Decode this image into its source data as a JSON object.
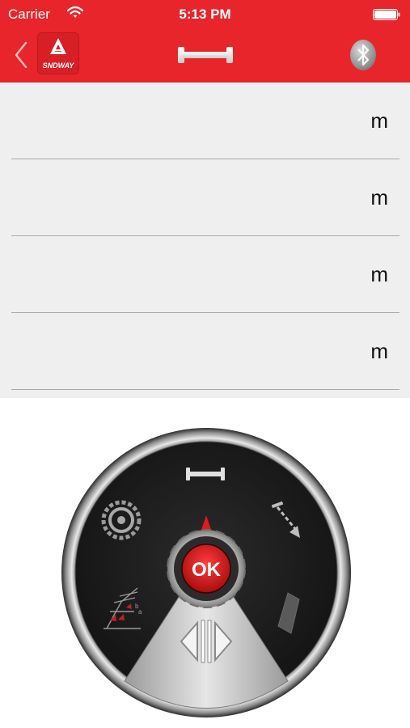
{
  "status_bar": {
    "carrier": "Carrier",
    "time": "5:13 PM"
  },
  "nav": {
    "logo_text": "SNDWAY"
  },
  "measurements": [
    {
      "value": "",
      "unit": "m"
    },
    {
      "value": "",
      "unit": "m"
    },
    {
      "value": "",
      "unit": "m"
    },
    {
      "value": "",
      "unit": "m"
    }
  ],
  "dial": {
    "ok_label": "OK"
  },
  "colors": {
    "accent": "#e8252b",
    "list_bg": "#efefef",
    "divider": "#a9a9a9"
  }
}
